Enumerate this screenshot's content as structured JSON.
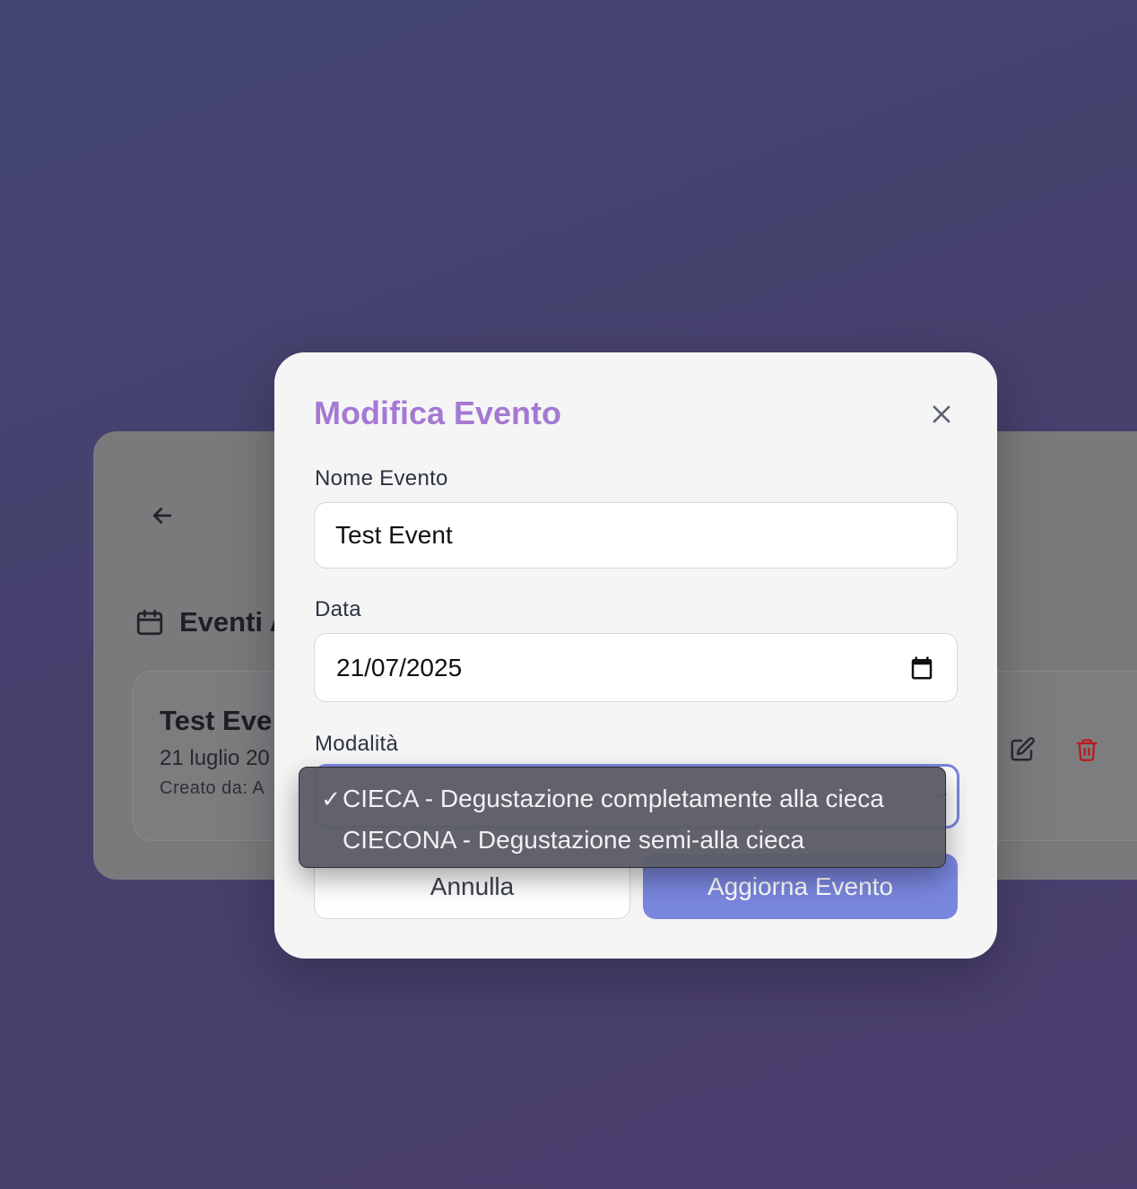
{
  "background": {
    "section_title": "Eventi A",
    "event": {
      "title": "Test Eve",
      "date": "21 luglio 20",
      "creator": "Creato da: A"
    }
  },
  "modal": {
    "title": "Modifica Evento",
    "fields": {
      "name_label": "Nome Evento",
      "name_value": "Test Event",
      "date_label": "Data",
      "date_value": "21/07/2025",
      "mode_label": "Modalità"
    },
    "dropdown": {
      "check_mark": "✓",
      "options": [
        {
          "label": "CIECA - Degustazione completamente alla cieca",
          "selected": true
        },
        {
          "label": "CIECONA - Degustazione semi-alla cieca",
          "selected": false
        }
      ]
    },
    "buttons": {
      "cancel": "Annulla",
      "submit": "Aggiorna Evento"
    }
  },
  "colors": {
    "title_accent": "#a479d3",
    "primary_button": "#7a87df",
    "delete_icon": "#b91c1c"
  }
}
